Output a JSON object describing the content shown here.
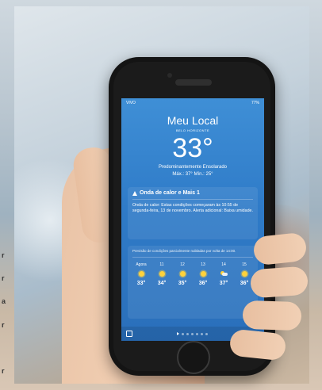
{
  "status": {
    "carrier": "VIVO",
    "battery": "77%"
  },
  "weather": {
    "title": "Meu Local",
    "subtitle": "BELO HORIZONTE",
    "temperature": "33°",
    "condition": "Predominantemente Ensolarado",
    "hilo": "Máx.: 37°  Mín.: 25°"
  },
  "alert": {
    "title": "Onda de calor e Mais 1",
    "body": "Onda de calor: Estas condições começaram às 10:55 de segunda-feira, 13 de novembro. Alerta adicional: Baixa umidade."
  },
  "forecast": {
    "note": "Previsão de condições parcialmente nubladas por volta de 14:00.",
    "hours": [
      {
        "label": "Agora",
        "icon": "sun-icon",
        "temp": "33°"
      },
      {
        "label": "11",
        "icon": "sun-icon",
        "temp": "34°"
      },
      {
        "label": "12",
        "icon": "sun-icon",
        "temp": "35°"
      },
      {
        "label": "13",
        "icon": "sun-icon",
        "temp": "36°"
      },
      {
        "label": "14",
        "icon": "partly-cloudy-icon",
        "temp": "37°"
      },
      {
        "label": "15",
        "icon": "sun-icon",
        "temp": "36°"
      }
    ]
  },
  "left_edge": [
    "r",
    "r",
    "a",
    "r",
    "r"
  ]
}
